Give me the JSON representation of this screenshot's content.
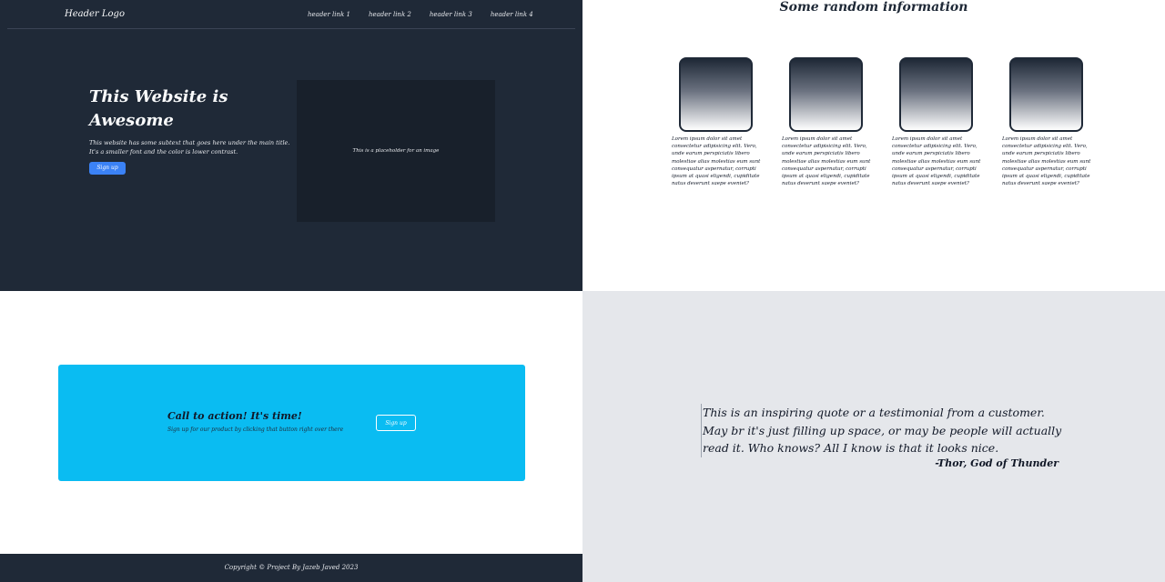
{
  "header": {
    "logo": "Header Logo",
    "links": [
      "header link 1",
      "header link 2",
      "header link 3",
      "header link 4"
    ]
  },
  "hero": {
    "title": "This Website is Awesome",
    "subtitle": "This website has some subtext that goes here under the main title. It's a smaller font and the color is lower contrast.",
    "button": "Sign up",
    "image_placeholder": "This is a placeholder for an image"
  },
  "info": {
    "title": "Some random information",
    "cards": [
      {
        "text": "Lorem ipsum dolor sit amet consectetur adipisicing elit. Vero, unde earum perspiciatis libero molestiae alias molestias eum sunt consequatur aspernatur, corrupti ipsum at quasi eligendi, cupiditate natus deserunt saepe eveniet?"
      },
      {
        "text": "Lorem ipsum dolor sit amet consectetur adipisicing elit. Vero, unde earum perspiciatis libero molestiae alias molestias eum sunt consequatur aspernatur, corrupti ipsum at quasi eligendi, cupiditate natus deserunt saepe eveniet?"
      },
      {
        "text": "Lorem ipsum dolor sit amet consectetur adipisicing elit. Vero, unde earum perspiciatis libero molestiae alias molestias eum sunt consequatur aspernatur, corrupti ipsum at quasi eligendi, cupiditate natus deserunt saepe eveniet?"
      },
      {
        "text": "Lorem ipsum dolor sit amet consectetur adipisicing elit. Vero, unde earum perspiciatis libero molestiae alias molestias eum sunt consequatur aspernatur, corrupti ipsum at quasi eligendi, cupiditate natus deserunt saepe eveniet?"
      }
    ]
  },
  "cta": {
    "title": "Call to action! It's time!",
    "subtitle": "Sign up for our product by clicking that button right over there",
    "button": "Sign up"
  },
  "quote": {
    "text": "This is an inspiring quote or a testimonial from a customer. May br it's just filling up space, or may be people will actually read it. Who knows? All I know is that it looks nice.",
    "author": "-Thor, God of Thunder"
  },
  "footer": {
    "text": "Copyright © Project By Jazeb Javed 2023"
  },
  "colors": {
    "dark": "#1f2937",
    "accent_blue": "#3b82f6",
    "cta_cyan": "#0abcf2",
    "quote_bg": "#e5e7eb"
  }
}
